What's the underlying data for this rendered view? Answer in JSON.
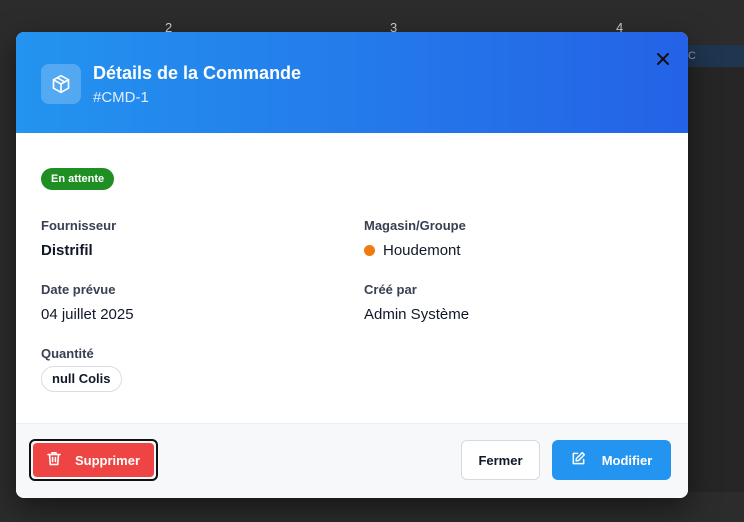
{
  "background": {
    "columns": [
      "2",
      "3",
      "4"
    ],
    "bar_text": "C"
  },
  "modal": {
    "title": "Détails de la Commande",
    "subtitle": "#CMD-1",
    "status": "En attente",
    "fields": {
      "supplier_label": "Fournisseur",
      "supplier_value": "Distrifil",
      "store_label": "Magasin/Groupe",
      "store_value": "Houdemont",
      "date_label": "Date prévue",
      "date_value": "04 juillet 2025",
      "created_label": "Créé par",
      "created_value": "Admin Système",
      "qty_label": "Quantité",
      "qty_value": "null Colis"
    },
    "footer": {
      "delete_label": "Supprimer",
      "close_label": "Fermer",
      "edit_label": "Modifier"
    }
  },
  "colors": {
    "header_start": "#2394ef",
    "header_end": "#2462e6",
    "status_badge": "#1f8f24",
    "store_dot": "#f07a0f",
    "delete": "#ef4444",
    "edit": "#2394ef"
  },
  "icons": {
    "header": "package-icon",
    "close": "close-icon",
    "delete": "trash-icon",
    "edit": "edit-icon"
  }
}
